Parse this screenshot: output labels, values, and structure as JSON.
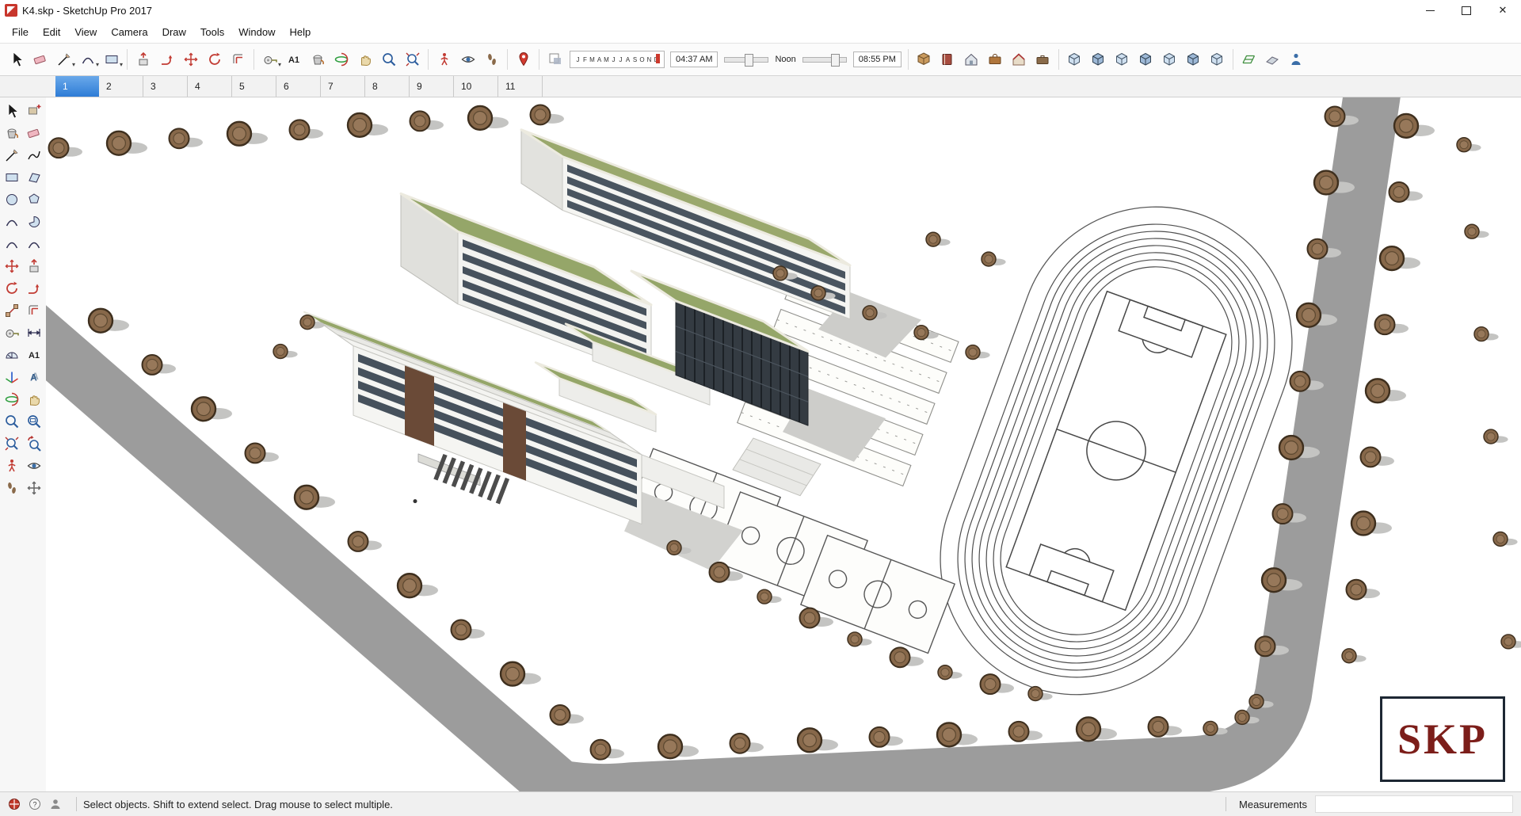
{
  "window": {
    "title": "K4.skp - SketchUp Pro 2017"
  },
  "menu": {
    "items": [
      "File",
      "Edit",
      "View",
      "Camera",
      "Draw",
      "Tools",
      "Window",
      "Help"
    ]
  },
  "toolbar": {
    "icons": [
      "select",
      "eraser",
      "line",
      "arc",
      "shapes",
      "push-pull",
      "follow-me",
      "move",
      "rotate",
      "offset",
      "tape-measure",
      "text",
      "paint-bucket",
      "orbit",
      "pan",
      "zoom",
      "zoom-extents",
      "position-camera",
      "look-around",
      "walk",
      "add-location",
      "shadows-toggle",
      "warehouse",
      "components",
      "materials",
      "styles",
      "instructor",
      "model-info",
      "x-ray",
      "back-edges",
      "wireframe",
      "hidden-line",
      "shaded",
      "shaded-textures",
      "monochrome",
      "terrain",
      "drape",
      "photo-textures"
    ],
    "shadows": {
      "months": [
        "J",
        "F",
        "M",
        "A",
        "M",
        "J",
        "J",
        "A",
        "S",
        "O",
        "N",
        "D"
      ],
      "time_start": "04:37 AM",
      "time_noon": "Noon",
      "time_end": "08:55 PM"
    }
  },
  "left_toolbar": {
    "icons": [
      "select",
      "make-component",
      "paint-bucket",
      "eraser",
      "line",
      "freehand",
      "rectangle",
      "rotated-rectangle",
      "circle",
      "polygon",
      "arc",
      "pie",
      "two-point-arc",
      "three-point-arc",
      "move",
      "push-pull",
      "rotate",
      "follow-me",
      "scale",
      "offset",
      "tape-measure",
      "dimensions",
      "protractor",
      "text",
      "axes",
      "3d-text",
      "orbit",
      "pan",
      "zoom",
      "zoom-window",
      "zoom-extents",
      "previous-view",
      "position-camera",
      "look-around",
      "walk",
      "next-view"
    ]
  },
  "scene_tabs": {
    "active": "1",
    "tabs": [
      "1",
      "2",
      "3",
      "4",
      "5",
      "6",
      "7",
      "8",
      "9",
      "10",
      "11"
    ]
  },
  "viewport": {
    "watermark": "SKP"
  },
  "status_bar": {
    "hint": "Select objects. Shift to extend select. Drag mouse to select multiple.",
    "measurements_label": "Measurements",
    "measurements_value": ""
  }
}
